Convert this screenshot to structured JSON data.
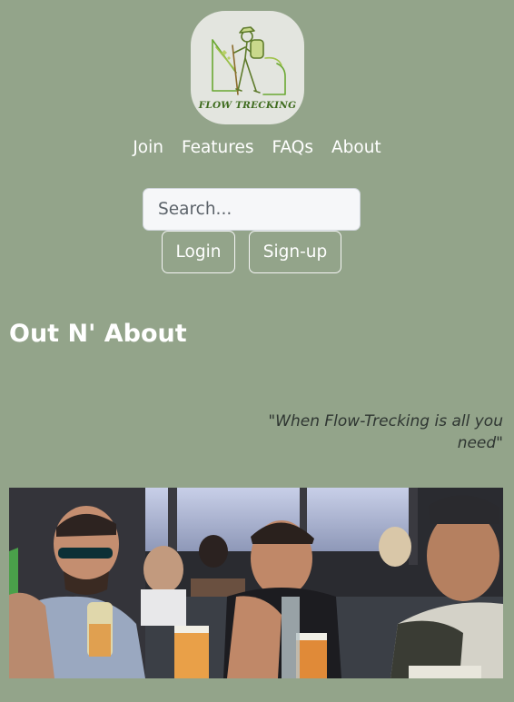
{
  "logo": {
    "text": "FLOW TRECKING",
    "icon": "hiker-icon"
  },
  "nav": {
    "items": [
      {
        "label": "Join"
      },
      {
        "label": "Features"
      },
      {
        "label": "FAQs"
      },
      {
        "label": "About"
      }
    ]
  },
  "search": {
    "placeholder": "Search..."
  },
  "auth": {
    "login_label": "Login",
    "signup_label": "Sign-up"
  },
  "main": {
    "title": "Out N' About",
    "quote": "\"When Flow-Trecking is all you need\""
  },
  "photo": {
    "name": "group-photo"
  },
  "colors": {
    "background": "#93a48a",
    "logo_bg": "#e3e5df",
    "logo_green": "#3f6c1f"
  }
}
